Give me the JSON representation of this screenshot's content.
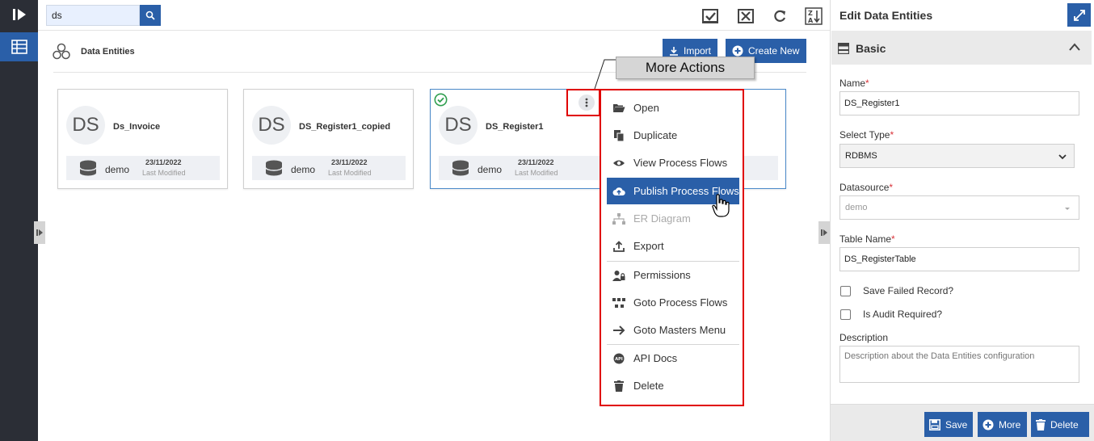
{
  "search": {
    "value": "ds"
  },
  "page": {
    "title": "Data Entities"
  },
  "actions": {
    "import_label": "Import",
    "create_label": "Create New"
  },
  "cards": [
    {
      "initials": "DS",
      "name": "Ds_Invoice",
      "datasource": "demo",
      "date": "23/11/2022",
      "date_label": "Last Modified"
    },
    {
      "initials": "DS",
      "name": "DS_Register1_copied",
      "datasource": "demo",
      "date": "23/11/2022",
      "date_label": "Last Modified"
    },
    {
      "initials": "DS",
      "name": "DS_Register1",
      "datasource": "demo",
      "date": "23/11/2022",
      "date_label": "Last Modified"
    }
  ],
  "callout": {
    "text": "More Actions"
  },
  "menu": [
    {
      "label": "Open",
      "icon": "folder-open-icon"
    },
    {
      "label": "Duplicate",
      "icon": "duplicate-icon"
    },
    {
      "label": "View Process Flows",
      "icon": "eye-icon"
    },
    {
      "label": "Publish Process Flows",
      "icon": "cloud-upload-icon"
    },
    {
      "label": "ER Diagram",
      "icon": "sitemap-icon"
    },
    {
      "label": "Export",
      "icon": "upload-icon"
    },
    {
      "label": "Permissions",
      "icon": "user-lock-icon"
    },
    {
      "label": "Goto Process Flows",
      "icon": "flow-icon"
    },
    {
      "label": "Goto Masters Menu",
      "icon": "arrow-right-icon"
    },
    {
      "label": "API Docs",
      "icon": "api-icon"
    },
    {
      "label": "Delete",
      "icon": "trash-icon"
    }
  ],
  "panel": {
    "title": "Edit Data Entities",
    "section": "Basic",
    "name_label": "Name",
    "name_value": "DS_Register1",
    "type_label": "Select Type",
    "type_value": "RDBMS",
    "datasource_label": "Datasource",
    "datasource_value": "demo",
    "table_label": "Table Name",
    "table_value": "DS_RegisterTable",
    "save_failed_label": "Save Failed Record?",
    "audit_label": "Is Audit Required?",
    "description_label": "Description",
    "description_placeholder": "Description about the Data Entities configuration",
    "required_mark": "*",
    "save_label": "Save",
    "more_label": "More",
    "delete_label": "Delete"
  },
  "colors": {
    "accent": "#2a5fa8",
    "nav": "#2b2e36",
    "highlight": "#e00000",
    "required": "#d9343a",
    "success": "#2e9e4e"
  }
}
